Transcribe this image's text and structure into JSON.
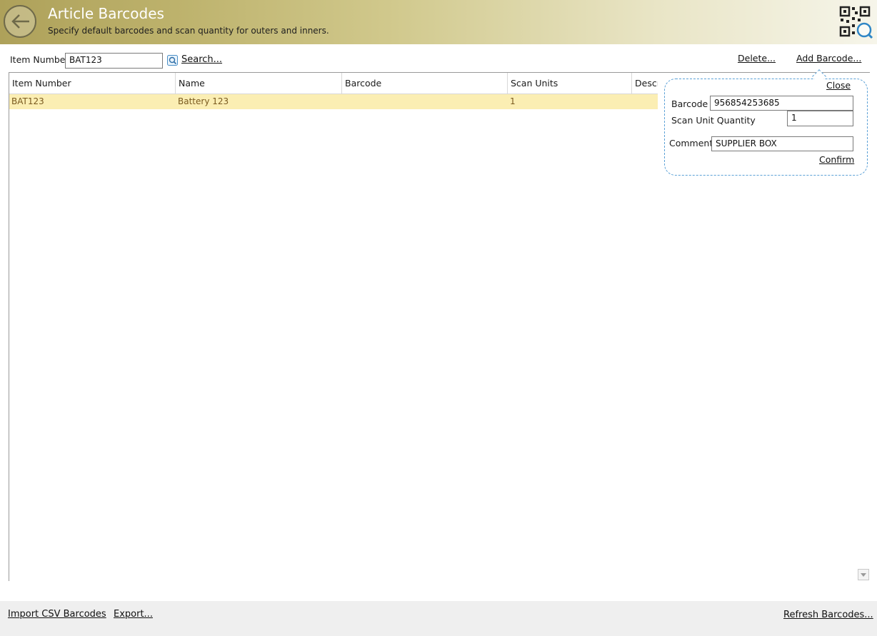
{
  "header": {
    "title": "Article Barcodes",
    "subtitle": "Specify default barcodes and scan quantity for outers and inners."
  },
  "search": {
    "item_number_label": "Item Number",
    "item_number_value": "BAT123",
    "search_link": "Search..."
  },
  "actions": {
    "delete": "Delete...",
    "add_barcode": "Add Barcode..."
  },
  "grid": {
    "columns": [
      "Item Number",
      "Name",
      "Barcode",
      "Scan Units",
      "Description"
    ],
    "rows": [
      {
        "item_number": "BAT123",
        "name": "Battery 123",
        "barcode": "",
        "scan_units": "1"
      }
    ],
    "selected_row_color": "#fbeeb3"
  },
  "popup": {
    "close": "Close",
    "barcode_label": "Barcode",
    "barcode_value": "956854253685",
    "scan_qty_label": "Scan Unit Quantity",
    "scan_qty_value": "1",
    "comment_label": "Comment",
    "comment_value": "SUPPLIER BOX",
    "confirm": "Confirm",
    "border_color": "#5aa0d6"
  },
  "footer": {
    "import": "Import CSV Barcodes",
    "export": "Export...",
    "refresh": "Refresh Barcodes..."
  },
  "icons": {
    "back": "back-arrow-icon",
    "app": "qr-search-icon",
    "search": "search-icon",
    "scroll": "scroll-down-icon"
  }
}
